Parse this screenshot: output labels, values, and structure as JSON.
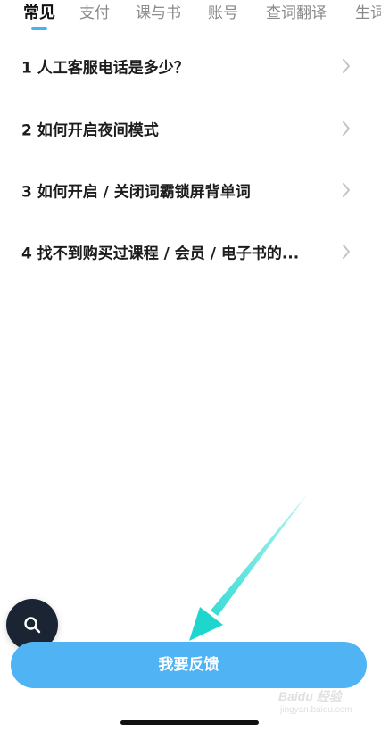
{
  "tabs": [
    {
      "label": "常见",
      "active": true
    },
    {
      "label": "支付",
      "active": false
    },
    {
      "label": "课与书",
      "active": false
    },
    {
      "label": "账号",
      "active": false
    },
    {
      "label": "查词翻译",
      "active": false
    },
    {
      "label": "生词",
      "active": false
    }
  ],
  "faq": [
    {
      "label": "1 人工客服电话是多少？"
    },
    {
      "label": "2 如何开启夜间模式"
    },
    {
      "label": "3 如何开启 / 关闭词霸锁屏背单词"
    },
    {
      "label": "4 找不到购买过课程 / 会员 / 电子书的..."
    }
  ],
  "feedback": {
    "label": "我要反馈"
  },
  "icons": {
    "search": "search-icon",
    "chevron": "chevron-right-icon"
  },
  "watermark": {
    "brand": "Baidu 经验",
    "url": "jingyan.baidu.com"
  },
  "colors": {
    "accent": "#4fb3f4",
    "fab": "#1b2433",
    "annotation": "#2ad9d2"
  }
}
